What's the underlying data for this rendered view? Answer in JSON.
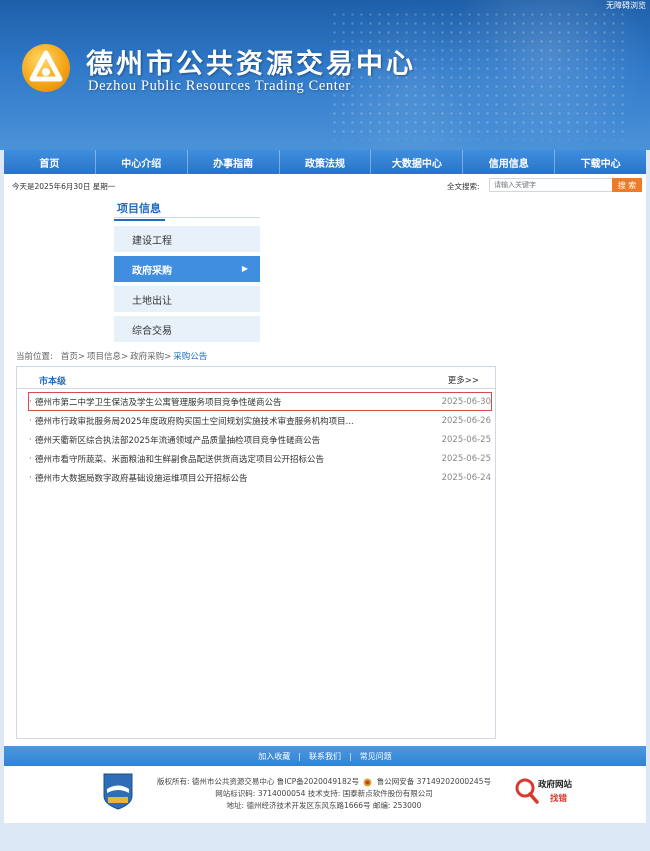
{
  "header": {
    "top_link": "无障碍浏览",
    "title": "德州市公共资源交易中心",
    "subtitle": "Dezhou Public Resources Trading Center"
  },
  "nav": [
    "首页",
    "中心介绍",
    "办事指南",
    "政策法规",
    "大数据中心",
    "信用信息",
    "下载中心"
  ],
  "topbar": {
    "date": "今天是2025年6月30日 星期一",
    "search_label": "全文搜索:",
    "search_placeholder": "请输入关键字",
    "search_button": "搜 索"
  },
  "sidebar": {
    "title": "项目信息",
    "items": [
      {
        "label": "建设工程"
      },
      {
        "label": "政府采购",
        "active": true
      },
      {
        "label": "土地出让"
      },
      {
        "label": "综合交易"
      }
    ]
  },
  "breadcrumb": {
    "prefix": "当前位置:",
    "items": [
      "首页>",
      "项目信息>",
      "政府采购>"
    ],
    "current": "采购公告"
  },
  "panel": {
    "title": "市本级",
    "more": "更多>>",
    "rows": [
      {
        "title": "德州市第二中学卫生保洁及学生公寓管理服务项目竞争性磋商公告",
        "date": "2025-06-30",
        "highlight": true
      },
      {
        "title": "德州市行政审批服务局2025年度政府购买国土空间规划实施技术审查服务机构项目...",
        "date": "2025-06-26"
      },
      {
        "title": "德州天衢新区综合执法部2025年流通领域产品质量抽检项目竞争性磋商公告",
        "date": "2025-06-25"
      },
      {
        "title": "德州市看守所蔬菜、米面粮油和生鲜副食品配送供货商选定项目公开招标公告",
        "date": "2025-06-25"
      },
      {
        "title": "德州市大数据局数字政府基础设施运维项目公开招标公告",
        "date": "2025-06-24"
      }
    ]
  },
  "footer_links": [
    "加入收藏",
    "联系我们",
    "常见问题"
  ],
  "footer_seps": [
    "|",
    "|"
  ],
  "footer": {
    "badge_text": "事业单位",
    "line1a": "版权所有: 德州市公共资源交易中心 鲁ICP备2020049182号",
    "line1b": "鲁公网安备 37149202000245号",
    "line2": "网站标识码: 3714000054 技术支持: 国泰新点软件股份有限公司",
    "line3": "地址: 德州经济技术开发区东风东路1666号 邮编: 253000",
    "gov_1": "政府网站",
    "gov_2": "找错"
  },
  "colors": {
    "primary": "#2a73c6",
    "accent": "#f07b27",
    "highlight": "#d84b4b"
  }
}
